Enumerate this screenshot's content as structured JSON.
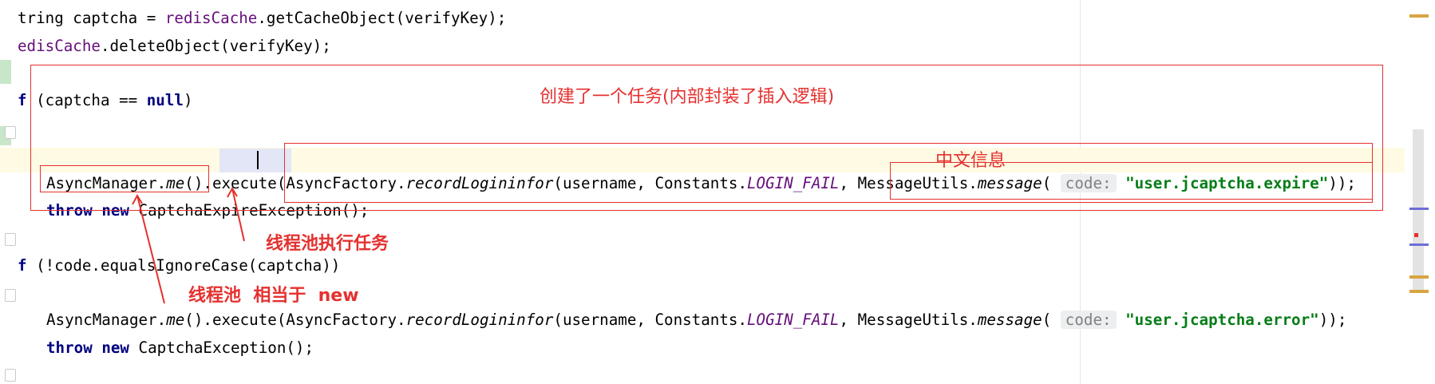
{
  "code": {
    "line1": {
      "a": "tring captcha = ",
      "b": "redisCache",
      "c": ".getCacheObject(verifyKey);"
    },
    "line2": {
      "a": "edisCache",
      "b": ".deleteObject(verifyKey);"
    },
    "line3": {
      "a": "f",
      "b": " (captcha == ",
      "c": "null",
      "d": ")"
    },
    "line4": {
      "a": "AsyncManager.",
      "b": "me",
      "c": "().",
      "d": "execute",
      "e": "(AsyncFactory.",
      "f": "recordLogininfor",
      "g": "(username, Constants.",
      "h": "LOGIN_FAIL",
      "i": ", MessageUtils.",
      "j": "message",
      "k": "( ",
      "l": "code:",
      "m": " ",
      "n": "\"user.jcaptcha.expire\"",
      "o": "));"
    },
    "line5": {
      "a": "throw",
      "b": " ",
      "c": "new",
      "d": " CaptchaExpireException();"
    },
    "line6": {
      "a": "f",
      "b": " (!code.equalsIgnoreCase(captcha))"
    },
    "line7": {
      "a": "AsyncManager.",
      "b": "me",
      "c": "().",
      "d": "execute",
      "e": "(AsyncFactory.",
      "f": "recordLogininfor",
      "g": "(username, Constants.",
      "h": "LOGIN_FAIL",
      "i": ", MessageUtils.",
      "j": "message",
      "k": "( ",
      "l": "code:",
      "m": " ",
      "n": "\"user.jcaptcha.error\"",
      "o": "));"
    },
    "line8": {
      "a": "throw",
      "b": " ",
      "c": "new",
      "d": " CaptchaException();"
    }
  },
  "annotations": {
    "task_created": "创建了一个任务(内部封装了插入逻辑)",
    "chinese_info": "中文信息",
    "pool_executes": "线程池执行任务",
    "pool_equals_new": "线程池  相当于  new"
  },
  "colors": {
    "annotation_red": "#e4312f",
    "keyword": "#000080",
    "string": "#067d17",
    "field": "#660e7a"
  }
}
